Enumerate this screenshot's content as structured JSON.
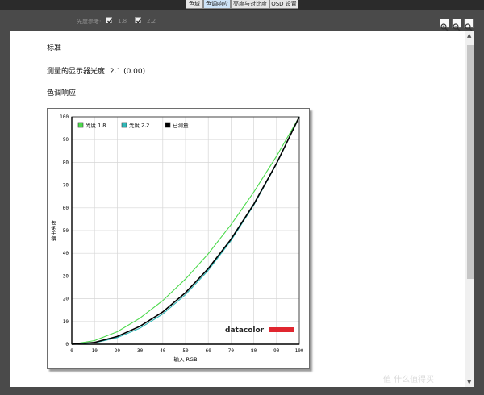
{
  "tabs": [
    {
      "label": "色域",
      "active": false
    },
    {
      "label": "色调响应",
      "active": true
    },
    {
      "label": "亮度与对比度",
      "active": false
    },
    {
      "label": "OSD 设置",
      "active": false
    }
  ],
  "toolbar": {
    "gamma_ref_label": "光度参考:",
    "gamma_option_1": "1.8",
    "gamma_option_2": "2.2",
    "gamma_option_1_checked": true,
    "gamma_option_2_checked": true,
    "zoom_icons": [
      "zoom-in-icon",
      "zoom-out-icon",
      "zoom-fit-icon"
    ]
  },
  "report": {
    "mode": "标准",
    "measured_gamma": "测量的显示器光度: 2.1 (0.00)",
    "section_title": "色调响应"
  },
  "chart_data": {
    "type": "line",
    "xlabel": "输入 RGB",
    "ylabel": "输出亮度",
    "xlim": [
      0,
      100
    ],
    "ylim": [
      0,
      100
    ],
    "xticks": [
      0,
      10,
      20,
      30,
      40,
      50,
      60,
      70,
      80,
      90,
      100
    ],
    "yticks": [
      0,
      10,
      20,
      30,
      40,
      50,
      60,
      70,
      80,
      90,
      100
    ],
    "grid": true,
    "legend_position": "top-left",
    "logo_text": "datacolor",
    "series": [
      {
        "name": "光度 1.8",
        "color": "#4cd94c",
        "x": [
          0,
          10,
          20,
          30,
          40,
          50,
          60,
          70,
          80,
          90,
          100
        ],
        "y": [
          0,
          1.6,
          5.5,
          11.5,
          19.2,
          28.7,
          39.8,
          52.6,
          66.9,
          82.7,
          100
        ]
      },
      {
        "name": "光度 2.2",
        "color": "#2fb8b8",
        "x": [
          0,
          10,
          20,
          30,
          40,
          50,
          60,
          70,
          80,
          90,
          100
        ],
        "y": [
          0,
          0.6,
          2.9,
          7.1,
          13.3,
          21.8,
          32.5,
          45.6,
          61.2,
          79.3,
          100
        ]
      },
      {
        "name": "已测量",
        "color": "#000000",
        "x": [
          0,
          10,
          20,
          30,
          40,
          50,
          60,
          70,
          80,
          90,
          100
        ],
        "y": [
          0,
          0.8,
          3.4,
          7.9,
          14.2,
          22.7,
          33.3,
          46.2,
          61.6,
          79.5,
          100
        ]
      }
    ]
  },
  "watermark": "值 什么值得买"
}
